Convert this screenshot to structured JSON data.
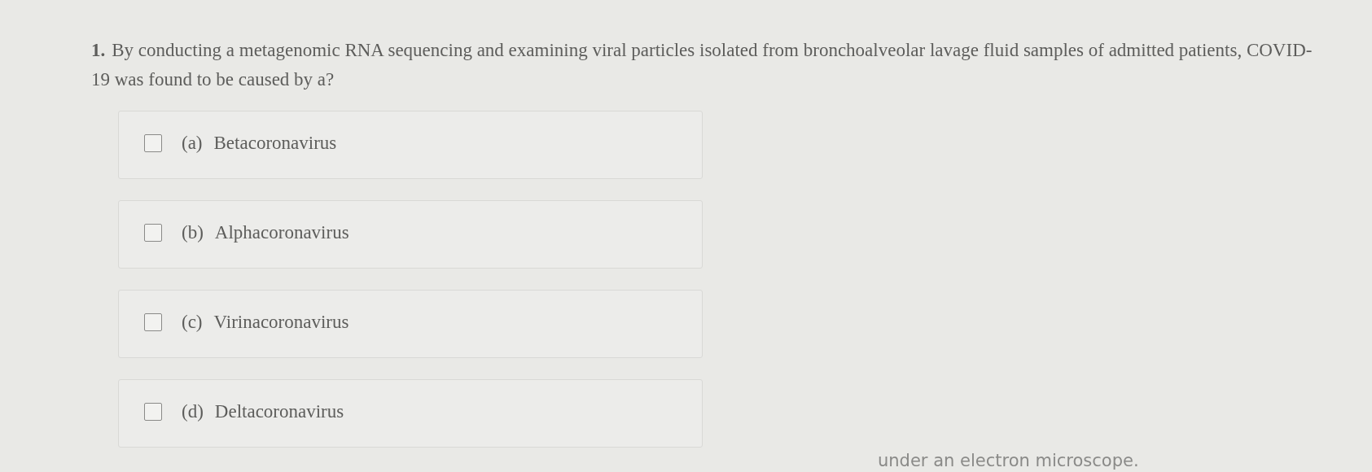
{
  "question": {
    "number": "1.",
    "text": "By conducting a metagenomic RNA sequencing and examining viral particles isolated from bronchoalveolar lavage fluid samples of admitted patients, COVID-19 was found to be caused by a?"
  },
  "options": [
    {
      "letter": "(a)",
      "label": "Betacoronavirus",
      "checked": false
    },
    {
      "letter": "(b)",
      "label": "Alphacoronavirus",
      "checked": false
    },
    {
      "letter": "(c)",
      "label": "Virinacoronavirus",
      "checked": false
    },
    {
      "letter": "(d)",
      "label": "Deltacoronavirus",
      "checked": false
    }
  ],
  "footer_text": "under an electron microscope."
}
